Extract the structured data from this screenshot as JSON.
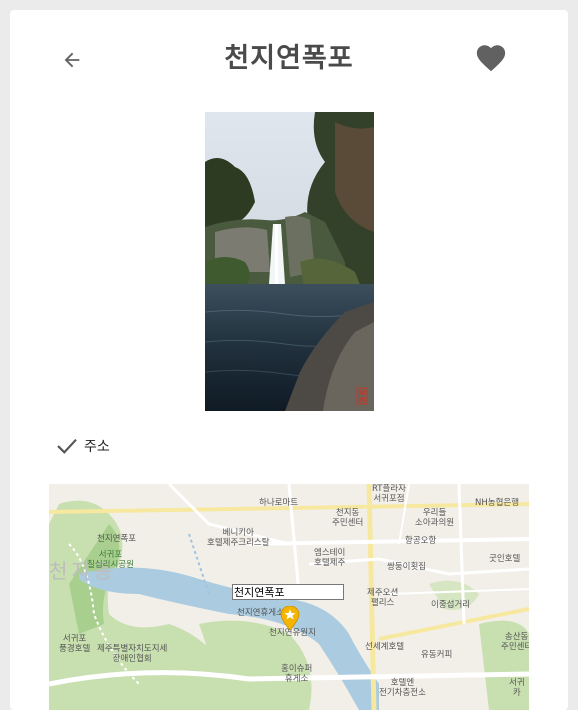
{
  "header": {
    "title": "천지연폭포",
    "back_icon": "arrow-left-icon",
    "favorite_icon": "heart-icon"
  },
  "detail": {
    "address_label": "주소",
    "address_icon": "check-icon"
  },
  "map": {
    "callout": "천지연폭포",
    "labels": {
      "l1": "하나로마트",
      "l2": "천지동\n주민센터",
      "l3": "RT플라자\n서귀포점",
      "l4": "우리들\n소아과의원",
      "l5": "NH농협은행",
      "l6": "천지연폭포",
      "l7": "서귀포\n칠십리시공원",
      "l8": "베니키아\n호텔제주크리스탈",
      "l9": "엠스테이\n호텔제주",
      "l10": "항공오항",
      "l11": "쌍둥이횟집",
      "l12": "굿인호텔",
      "l13": "천지연휴게소",
      "l14": "제주오션\n팰리스",
      "l15": "이중섭거리",
      "l16": "천지연유원지",
      "l17": "서귀포\n풍경호텔",
      "l18": "제주특별자치도지세\n장애인협회",
      "l19": "송산동\n주민센터",
      "l20": "선세계호텔",
      "l21": "유동커피",
      "l22": "홍이슈퍼\n휴게소",
      "l23": "호텔엔\n전기차충전소",
      "l24": "서귀\n카",
      "district": "천지동"
    }
  },
  "colors": {
    "title": "#4a4a4a",
    "heart": "#616161",
    "map_bg": "#f2efe9",
    "map_park": "#c8dfb0",
    "map_water": "#aacbe0",
    "map_road": "#ffffff",
    "map_main_road": "#f7e8a0",
    "pin": "#f4b400"
  }
}
